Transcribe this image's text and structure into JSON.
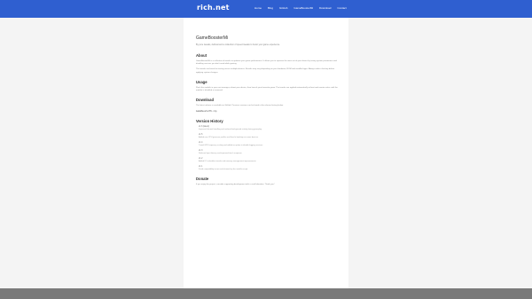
{
  "header": {
    "brand": "rich.net",
    "nav": [
      "Home",
      "Blog",
      "GitHub",
      "GameBoosterMi",
      "Download",
      "Contact"
    ]
  },
  "page": {
    "title": "GameBoosterMi",
    "subtitle": "By pure tweaks, debloat and a collection of speed tweaks to boost your game experience.",
    "about_heading": "About",
    "about_p1": "GameBoosterMi is a collection of tweaks to optimize your game performance. It allows you to squeeze the most out of your device by tuning system parameters and disabling services you don't need while gaming.",
    "about_p2": "The tweaks are based on testing across multiple devices. Results may vary depending on your hardware, ROM and installed apps. Always make a backup before applying system changes.",
    "usage_heading": "Usage",
    "usage_p1": "Flash the module in your root manager, reboot your device, then launch your favourite game. The tweaks are applied automatically at boot and remain active until the module is disabled or removed.",
    "download_heading": "Download",
    "download_p1": "The latest release is available on GitHub. Previous versions can be found in the release history below.",
    "download_code": "GameBoosterMi.zip",
    "history_heading": "Version History",
    "history": [
      {
        "version": "v1.6 (latest)",
        "desc": "Improved thermal handling and reduced background activity during gameplay."
      },
      {
        "version": "v1.5",
        "desc": "Added new CPU governor profiles and fixed a bootloop on some devices."
      },
      {
        "version": "v1.4",
        "desc": "Tuned GPU frequency scaling and added an option to disable logging services."
      },
      {
        "version": "v1.3",
        "desc": "Reduced input latency and improved touch response."
      },
      {
        "version": "v1.2",
        "desc": "Added I/O scheduler tweaks and memory management improvements."
      },
      {
        "version": "v1.1",
        "desc": "Fixed compatibility issues and cleaned up the installer script."
      }
    ],
    "donate_heading": "Donate",
    "donate_p1": "If you enjoy the project, consider supporting development with a small donation. Thank you!"
  }
}
